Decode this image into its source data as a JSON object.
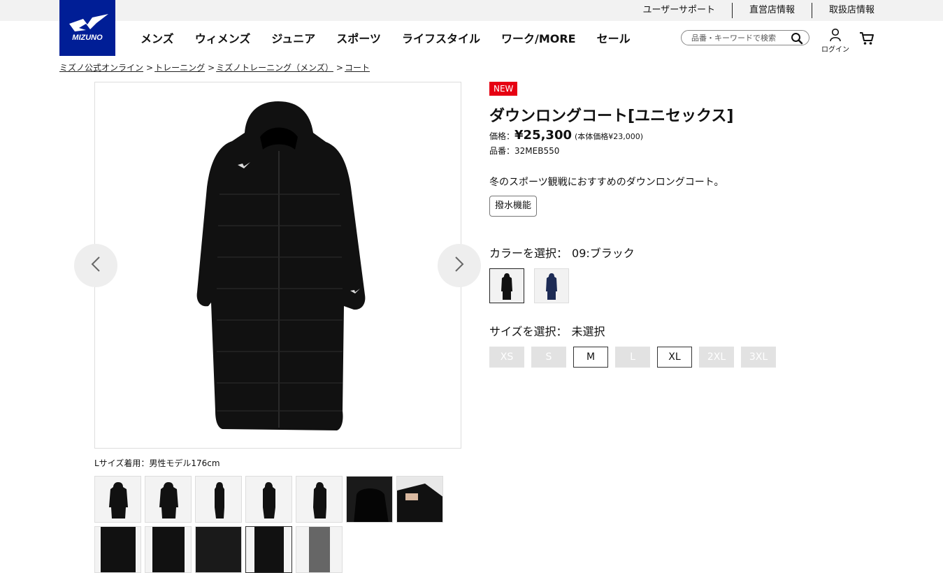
{
  "header": {
    "logo_text": "MIZUNO",
    "utility_links": [
      "ユーザーサポート",
      "直営店情報",
      "取扱店情報"
    ],
    "nav": [
      "メンズ",
      "ウィメンズ",
      "ジュニア",
      "スポーツ",
      "ライフスタイル",
      "ワーク/MORE",
      "セール"
    ],
    "search_placeholder": "品番・キーワードで検索",
    "login_label": "ログイン"
  },
  "breadcrumb": [
    "ミズノ公式オンライン",
    "トレーニング",
    "ミズノトレーニング（メンズ）",
    "コート"
  ],
  "gallery": {
    "caption": "Lサイズ着用：男性モデル176cm",
    "thumb_count": 12,
    "selected_thumb_index": 10
  },
  "product": {
    "badge": "NEW",
    "title": "ダウンロングコート[ユニセックス]",
    "price_label": "価格：",
    "price": "¥25,300",
    "price_sub": "(本体価格¥23,000)",
    "sku": "品番：32MEB550",
    "description": "冬のスポーツ観戦におすすめのダウンロングコート。",
    "feature_tag": "撥水機能",
    "color_label": "カラーを選択：",
    "color_value": "09:ブラック",
    "colors": [
      "black",
      "navy"
    ],
    "size_label": "サイズを選択：",
    "size_value": "未選択",
    "sizes": [
      {
        "label": "XS",
        "available": false
      },
      {
        "label": "S",
        "available": false
      },
      {
        "label": "M",
        "available": true
      },
      {
        "label": "L",
        "available": false
      },
      {
        "label": "XL",
        "available": true
      },
      {
        "label": "2XL",
        "available": false
      },
      {
        "label": "3XL",
        "available": false
      }
    ]
  },
  "colors": {
    "brand_blue": "#001e96",
    "badge_red": "#e60012",
    "unavailable_size_bg": "#e2e2e2"
  },
  "icons": [
    "mizuno-runbird-logo",
    "search-icon",
    "user-icon",
    "cart-icon",
    "chevron-left-icon",
    "chevron-right-icon"
  ]
}
